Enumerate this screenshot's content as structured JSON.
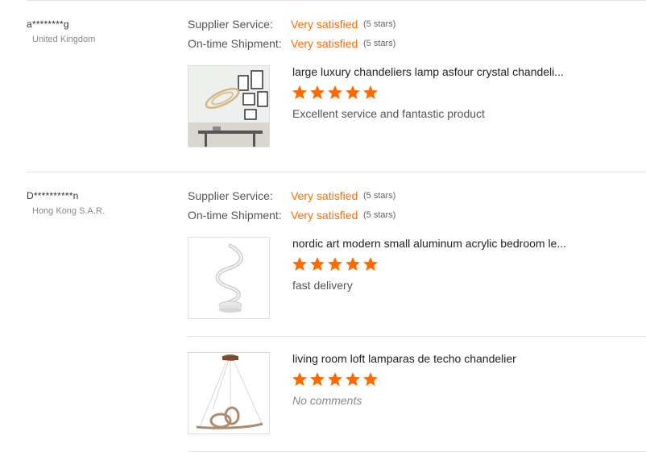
{
  "colors": {
    "accent": "#ff6a00",
    "star": "#ff6a00",
    "divider": "#e3e3e3"
  },
  "reviews": [
    {
      "buyer": "a********g",
      "country": "United Kingdom",
      "ratings": [
        {
          "label": "Supplier Service:",
          "value": "Very satisfied",
          "stars_text": "(5 stars)"
        },
        {
          "label": "On-time Shipment:",
          "value": "Very satisfied",
          "stars_text": "(5 stars)"
        }
      ],
      "products": [
        {
          "title": "large luxury chandeliers lamp asfour crystal chandeli...",
          "stars": 5,
          "comment": "Excellent service and fantastic product",
          "thumb_icon": "crystal-ring-chandelier-photo"
        }
      ]
    },
    {
      "buyer": "D**********n",
      "country": "Hong Kong S.A.R.",
      "ratings": [
        {
          "label": "Supplier Service:",
          "value": "Very satisfied",
          "stars_text": "(5 stars)"
        },
        {
          "label": "On-time Shipment:",
          "value": "Very satisfied",
          "stars_text": "(5 stars)"
        }
      ],
      "products": [
        {
          "title": "nordic art modern small aluminum acrylic bedroom le...",
          "stars": 5,
          "comment": "fast delivery",
          "thumb_icon": "spiral-table-lamp-photo"
        },
        {
          "title": "living room loft lamparas de techo chandelier",
          "stars": 5,
          "comment": "No comments",
          "thumb_icon": "pendant-ring-chandelier-photo"
        }
      ]
    }
  ]
}
